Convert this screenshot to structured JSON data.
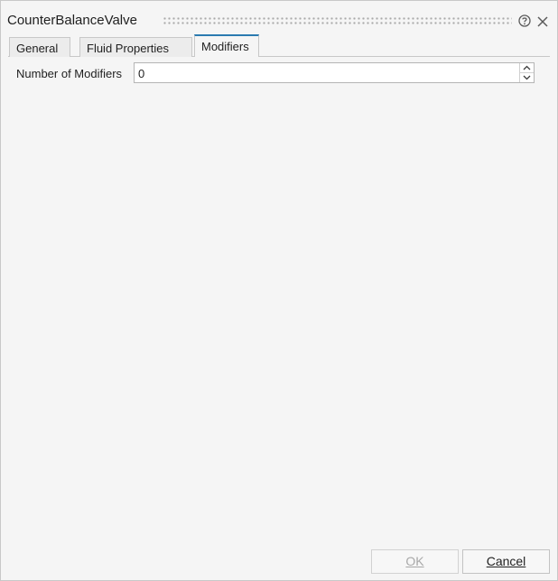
{
  "dialog": {
    "title": "CounterBalanceValve",
    "help_icon": "help-circle-icon",
    "close_icon": "close-icon"
  },
  "tabs": [
    {
      "label": "General",
      "active": false
    },
    {
      "label": "Fluid Properties",
      "active": false
    },
    {
      "label": "Modifiers",
      "active": true
    }
  ],
  "modifiers": {
    "count_label": "Number of Modifiers",
    "count_value": "0"
  },
  "footer": {
    "ok_label": "OK",
    "cancel_label": "Cancel"
  },
  "colors": {
    "accent": "#2a7ab0",
    "background": "#f5f5f5",
    "disabled_text": "#a8a8a8"
  }
}
